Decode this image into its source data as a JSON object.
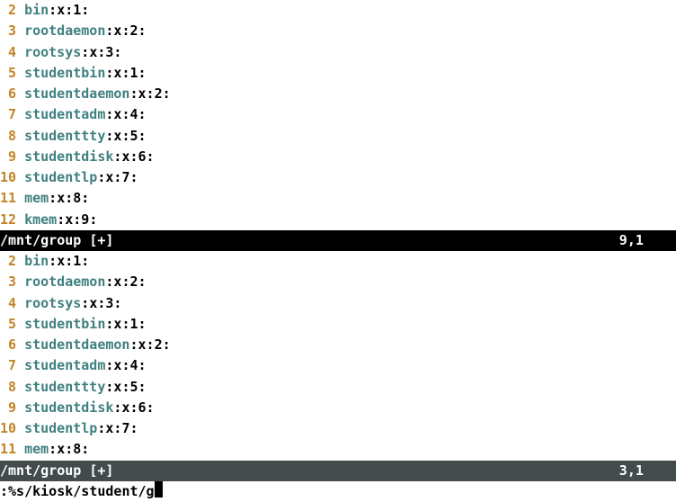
{
  "pane1": {
    "lines": [
      {
        "num": "2",
        "name": "bin",
        "gid": "1"
      },
      {
        "num": "3",
        "name": "rootdaemon",
        "gid": "2"
      },
      {
        "num": "4",
        "name": "rootsys",
        "gid": "3"
      },
      {
        "num": "5",
        "name": "studentbin",
        "gid": "1"
      },
      {
        "num": "6",
        "name": "studentdaemon",
        "gid": "2"
      },
      {
        "num": "7",
        "name": "studentadm",
        "gid": "4"
      },
      {
        "num": "8",
        "name": "studenttty",
        "gid": "5"
      },
      {
        "num": "9",
        "name": "studentdisk",
        "gid": "6"
      },
      {
        "num": "10",
        "name": "studentlp",
        "gid": "7"
      },
      {
        "num": "11",
        "name": "mem",
        "gid": "8"
      },
      {
        "num": "12",
        "name": "kmem",
        "gid": "9"
      }
    ],
    "status": {
      "file": "/mnt/group [+]",
      "pos": "9,1"
    }
  },
  "pane2": {
    "lines": [
      {
        "num": "2",
        "name": "bin",
        "gid": "1"
      },
      {
        "num": "3",
        "name": "rootdaemon",
        "gid": "2"
      },
      {
        "num": "4",
        "name": "rootsys",
        "gid": "3"
      },
      {
        "num": "5",
        "name": "studentbin",
        "gid": "1"
      },
      {
        "num": "6",
        "name": "studentdaemon",
        "gid": "2"
      },
      {
        "num": "7",
        "name": "studentadm",
        "gid": "4"
      },
      {
        "num": "8",
        "name": "studenttty",
        "gid": "5"
      },
      {
        "num": "9",
        "name": "studentdisk",
        "gid": "6"
      },
      {
        "num": "10",
        "name": "studentlp",
        "gid": "7"
      },
      {
        "num": "11",
        "name": "mem",
        "gid": "8"
      }
    ],
    "status": {
      "file": "/mnt/group [+]",
      "pos": "3,1"
    }
  },
  "cmdline": ":%s/kiosk/student/g",
  "sep": {
    "colon": ":",
    "x": "x"
  }
}
